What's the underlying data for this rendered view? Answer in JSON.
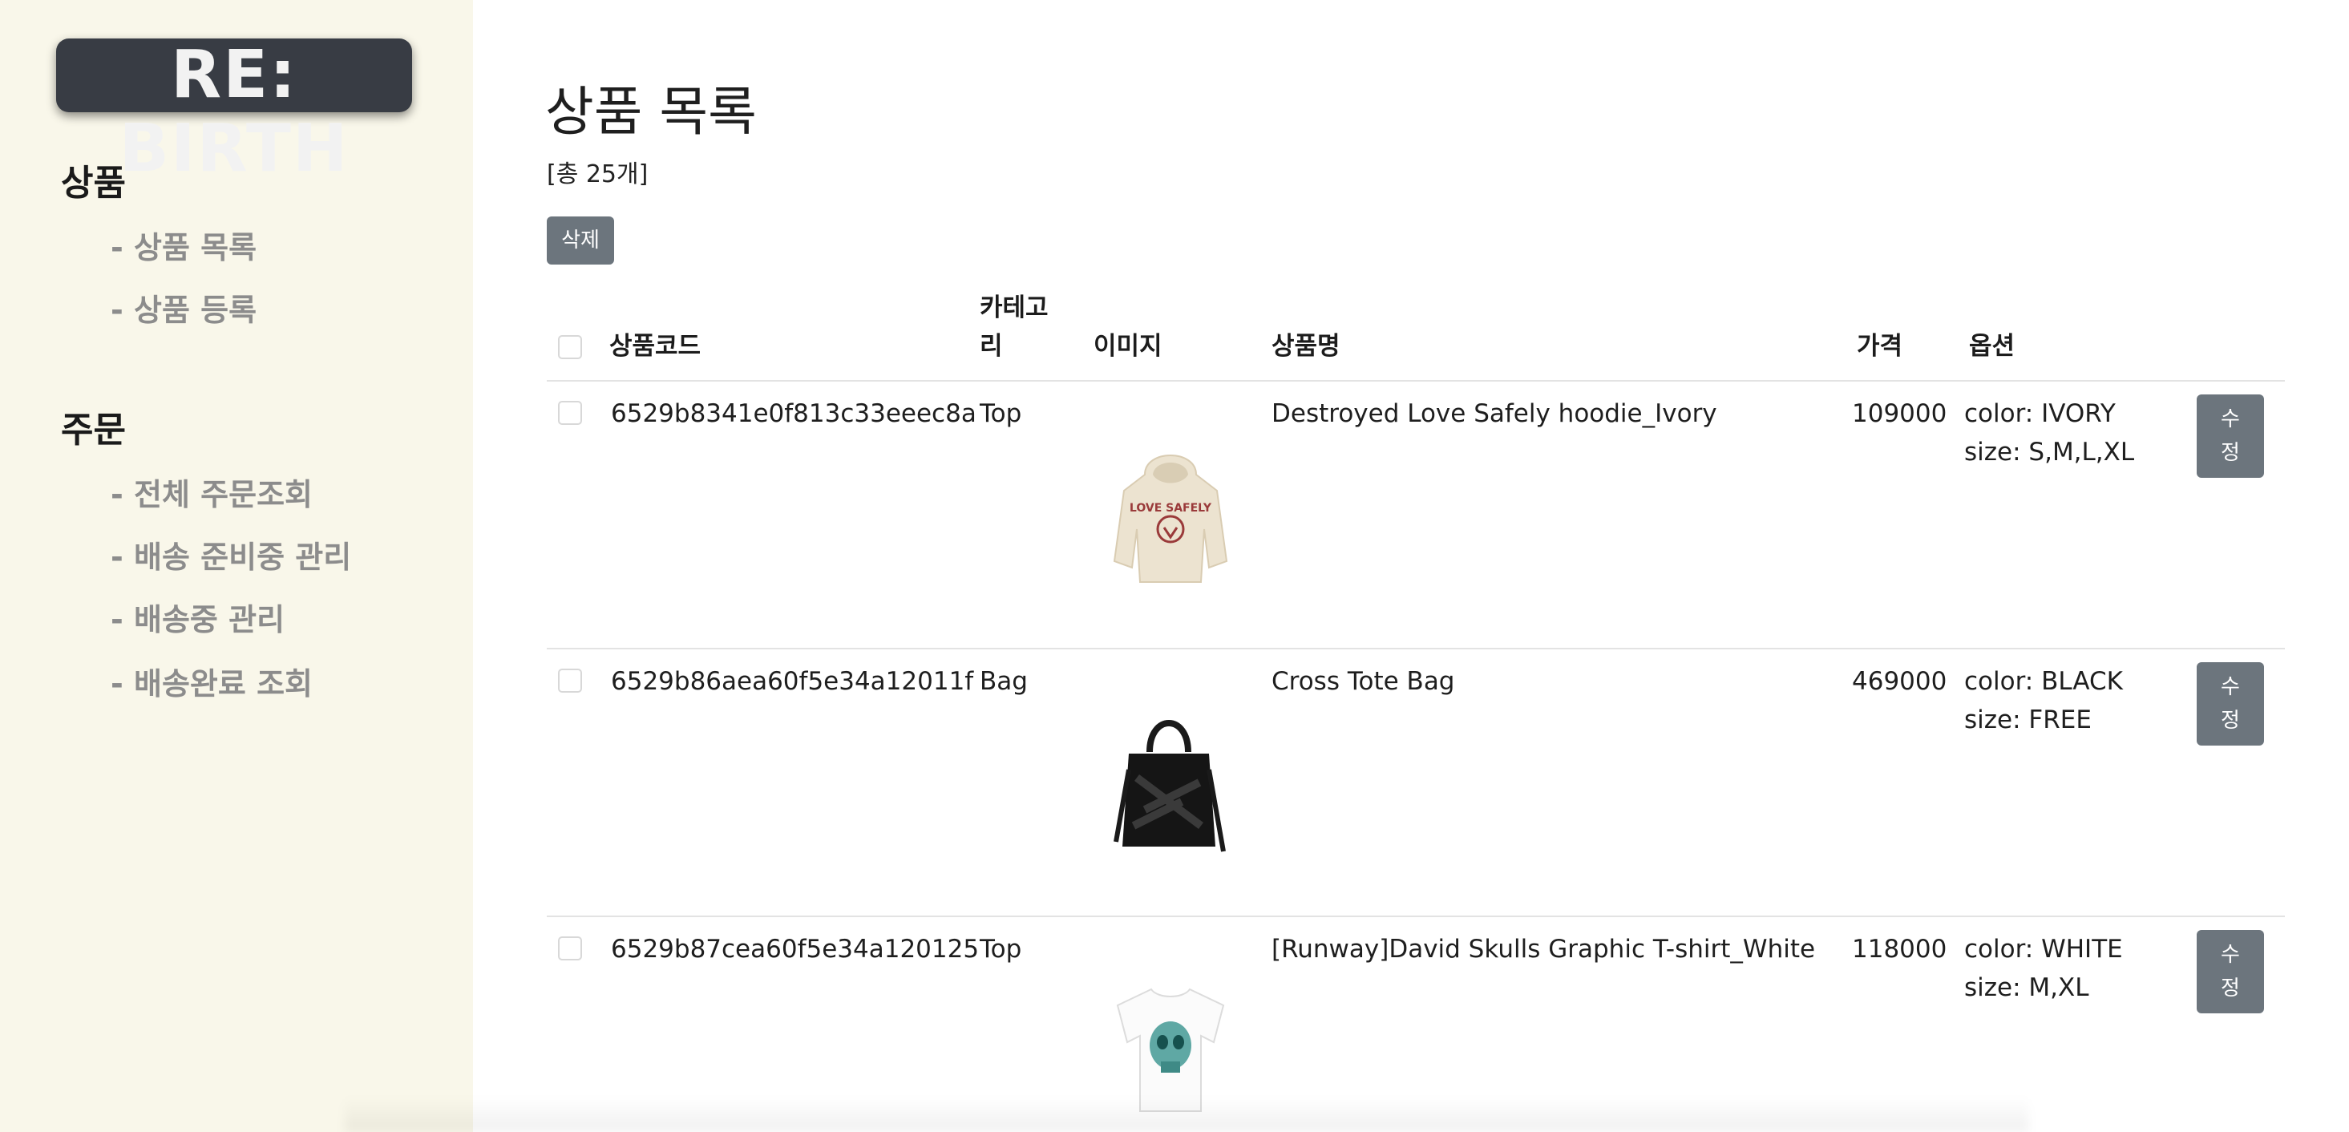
{
  "sidebar": {
    "logo": "RE: BIRTH",
    "sections": [
      {
        "title": "상품",
        "items": [
          "- 상품 목록",
          "- 상품 등록"
        ]
      },
      {
        "title": "주문",
        "items": [
          "- 전체 주문조회",
          "- 배송 준비중 관리",
          "- 배송중 관리",
          "- 배송완료 조회"
        ]
      }
    ]
  },
  "main": {
    "title": "상품 목록",
    "total": "[총 25개]",
    "delete_label": "삭제",
    "columns": {
      "code": "상품코드",
      "category_line1": "카테고",
      "category_line2": "리",
      "image": "이미지",
      "name": "상품명",
      "price": "가격",
      "option": "옵션"
    },
    "edit_label_line1": "수",
    "edit_label_line2": "정",
    "rows": [
      {
        "code": "6529b8341e0f813c33eeec8a",
        "category": "Top",
        "image": "hoodie-ivory-photo",
        "name": "Destroyed Love Safely hoodie_Ivory",
        "price": "109000",
        "color": "color: IVORY",
        "size": "size: S,M,L,XL"
      },
      {
        "code": "6529b86aea60f5e34a12011f",
        "category": "Bag",
        "image": "black-tote-bag-photo",
        "name": "Cross Tote Bag",
        "price": "469000",
        "color": "color: BLACK",
        "size": "size: FREE"
      },
      {
        "code": "6529b87cea60f5e34a120125",
        "category": "Top",
        "image": "white-skull-tshirt-photo",
        "name": "[Runway]David Skulls Graphic T-shirt_White",
        "price": "118000",
        "color": "color: WHITE",
        "size": "size: M,XL"
      }
    ]
  },
  "colors": {
    "sidebar_bg": "#f9f7ea",
    "logo_bg": "#383c44",
    "button_bg": "#6c757d",
    "menu_text": "#8c8c8c"
  }
}
